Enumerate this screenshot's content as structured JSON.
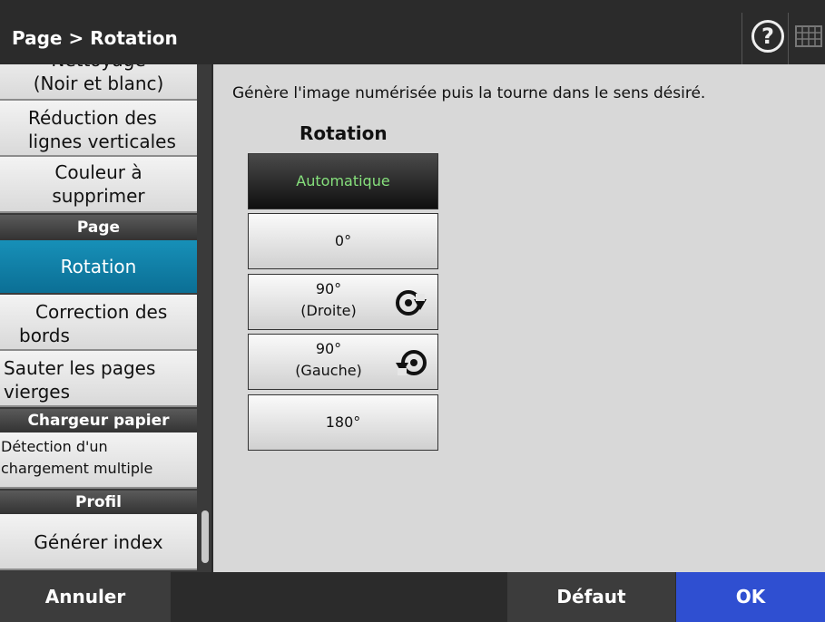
{
  "header": {
    "title": "Page > Rotation",
    "help_icon": "help-circle-icon",
    "keyboard_icon": "keyboard-icon"
  },
  "sidebar": {
    "items": [
      {
        "lines": [
          "Nettoyage",
          "(Noir et blanc)"
        ]
      },
      {
        "lines": [
          "Réduction des",
          "lignes verticales"
        ]
      },
      {
        "lines": [
          "Couleur à",
          "supprimer"
        ]
      },
      {
        "section": "Page"
      },
      {
        "lines": [
          "Rotation"
        ],
        "active": true
      },
      {
        "lines": [
          "Correction des",
          "bords"
        ]
      },
      {
        "lines": [
          "Sauter les pages",
          "vierges"
        ]
      },
      {
        "section": "Chargeur papier"
      },
      {
        "lines": [
          "Détection d'un",
          "chargement multiple"
        ]
      },
      {
        "section": "Profil"
      },
      {
        "lines": [
          "Générer index"
        ]
      }
    ]
  },
  "main": {
    "description": "Génère l'image numérisée puis la tourne dans le sens désiré.",
    "rotation_title": "Rotation",
    "options": [
      {
        "lines": [
          "Automatique"
        ],
        "selected": true
      },
      {
        "lines": [
          "0°"
        ]
      },
      {
        "lines": [
          "90°",
          "(Droite)"
        ],
        "icon": "rotate-right-icon"
      },
      {
        "lines": [
          "90°",
          "(Gauche)"
        ],
        "icon": "rotate-left-icon"
      },
      {
        "lines": [
          "180°"
        ]
      }
    ]
  },
  "footer": {
    "cancel": "Annuler",
    "default": "Défaut",
    "ok": "OK"
  },
  "colors": {
    "active": "#0b7fa8",
    "ok": "#2f4fd1",
    "selected_text": "#86e07c"
  }
}
